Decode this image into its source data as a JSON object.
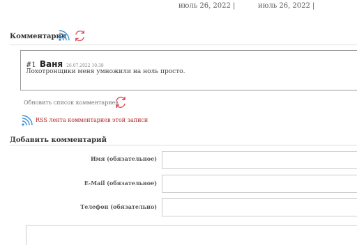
{
  "header": {
    "dates": [
      "июль 26, 2022  |",
      "июль 26, 2022  |"
    ]
  },
  "comments": {
    "title": "Комментарии",
    "items": [
      {
        "number": "#1",
        "author": "Ваня",
        "date": "26.07.2022 10:38",
        "text": "Лохотронщики меня умножили на ноль просто."
      }
    ],
    "refresh_label": "Обновить список комментариев",
    "rss_label": "RSS лента комментариев этой записи"
  },
  "form": {
    "title": "Добавить комментарий",
    "name_label": "Имя (обязательное)",
    "email_label": "E-Mail (обязательное)",
    "phone_label": "Телефон (обязательно)"
  },
  "icons": {
    "rss": "rss-icon",
    "refresh": "refresh-icon"
  },
  "colors": {
    "rss_blue": "#3a8fd6",
    "refresh_red": "#e0414d",
    "link_red": "#b22222"
  }
}
